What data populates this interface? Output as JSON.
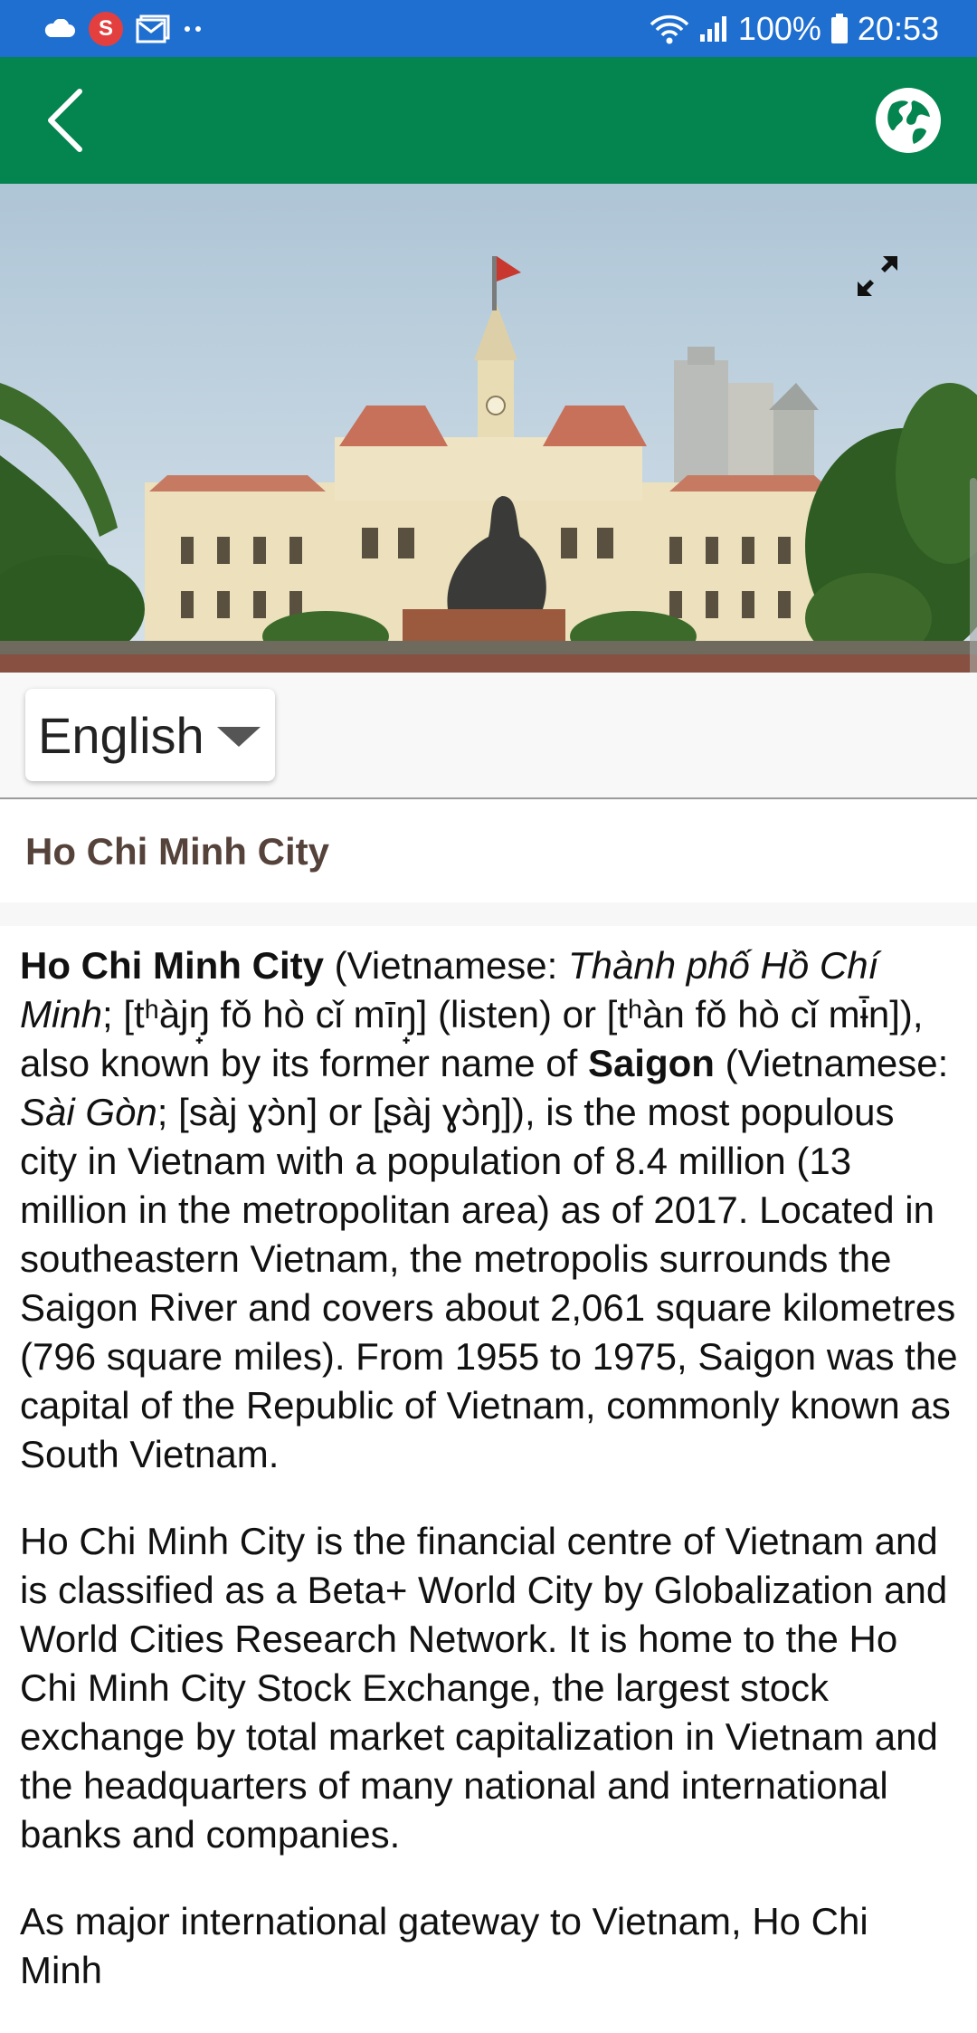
{
  "status_bar": {
    "battery": "100%",
    "time": "20:53",
    "notification_badge": "S",
    "icons": [
      "cloud-icon",
      "s-notification-icon",
      "mail-icon",
      "more-dots-icon",
      "wifi-icon",
      "signal-icon",
      "battery-icon"
    ]
  },
  "app_bar": {
    "back_icon": "chevron-left-icon",
    "globe_icon": "globe-icon",
    "color": "#04844e"
  },
  "language": {
    "selected": "English"
  },
  "page": {
    "title": "Ho Chi Minh City"
  },
  "article": {
    "p1": {
      "name": "Ho Chi Minh City",
      "t1": " (Vietnamese: ",
      "vn_name": "Thành phố Hồ Chí Minh",
      "t2": "; [tʰàjŋ̟ fǒ hò cǐ mīŋ̟] (listen) or [tʰàn fǒ hò cǐ mɨ̄n]), also known by its former name of ",
      "former": "Saigon",
      "t3": " (Vietnamese: ",
      "vn_former": "Sài Gòn",
      "t4": "; [sàj ɣɔ̀n] or [ʂàj ɣɔ̀ŋ]), is the most populous city in Vietnam with a population of 8.4 million (13 million in the metropolitan area) as of 2017. Located in southeastern Vietnam, the metropolis surrounds the Saigon River and covers about 2,061 square kilometres (796 square miles). From 1955 to 1975, Saigon was the capital of the Republic of Vietnam, commonly known as South Vietnam."
    },
    "p2": "Ho Chi Minh City is the financial centre of Vietnam and is classified as a Beta+ World City by Globalization and World Cities Research Network. It is home to the Ho Chi Minh City Stock Exchange, the largest stock exchange by total market capitalization in Vietnam and the headquarters of many national and international banks and companies.",
    "p3": "As major international gateway to Vietnam, Ho Chi Minh"
  }
}
